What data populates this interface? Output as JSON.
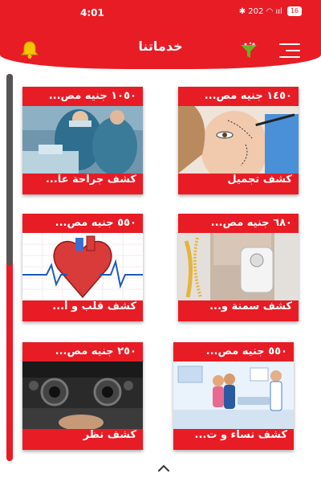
{
  "status_bar": {
    "time": "4:01",
    "indicators": "✱ 202 ◠ ııl",
    "battery": "16"
  },
  "app_bar": {
    "title": "خدماتنا",
    "left_icon": "bell-icon",
    "right_icons": [
      "filter-icon",
      "menu-icon"
    ]
  },
  "services": [
    {
      "price": "١٠٥٠ جنيه مص...",
      "name": "كشف جراحة عا...",
      "image": "surgery-photo"
    },
    {
      "price": "١٤٥٠ جنيه مص...",
      "name": "كشف تجميل",
      "image": "cosmetic-face-photo"
    },
    {
      "price": "٥٥٠ جنيه مص...",
      "name": "كشف قلب و أ...",
      "image": "heart-illustration"
    },
    {
      "price": "٦٨٠ جنيه مص...",
      "name": "كشف سمنة و...",
      "image": "weight-scale-photo"
    },
    {
      "price": "٢٥٠ جنيه مص...",
      "name": "كشف نظر",
      "image": "eye-exam-photo"
    },
    {
      "price": "٥٥٠ جنيه مص...",
      "name": "كشف نساء و ت...",
      "image": "gynecology-illustration"
    }
  ],
  "colors": {
    "primary": "#e81c25",
    "bell": "#f5c400",
    "filter": "#6ab023"
  }
}
